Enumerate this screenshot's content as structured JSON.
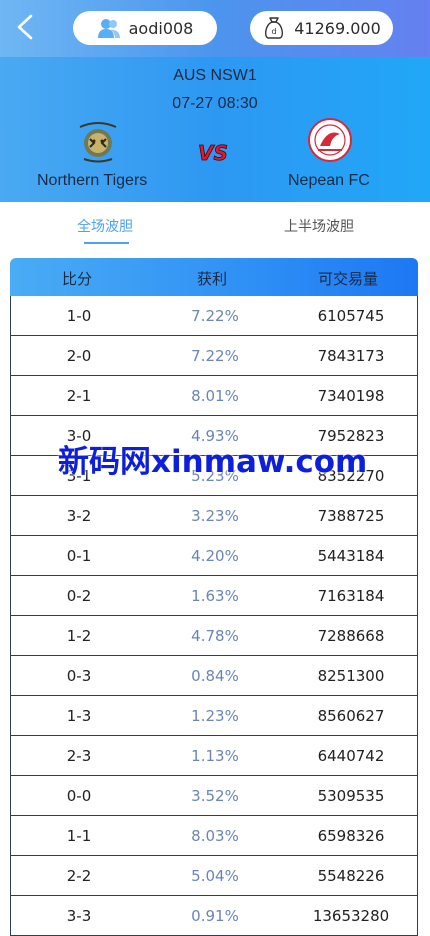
{
  "header": {
    "username": "aodi008",
    "balance": "41269.000"
  },
  "match": {
    "league": "AUS NSW1",
    "time": "07-27 08:30",
    "home_team": "Northern Tigers",
    "away_team": "Nepean FC"
  },
  "tabs": [
    {
      "label": "全场波胆",
      "active": true
    },
    {
      "label": "上半场波胆",
      "active": false
    }
  ],
  "table": {
    "headers": [
      "比分",
      "获利",
      "可交易量"
    ],
    "rows": [
      {
        "score": "1-0",
        "profit": "7.22%",
        "volume": "6105745"
      },
      {
        "score": "2-0",
        "profit": "7.22%",
        "volume": "7843173"
      },
      {
        "score": "2-1",
        "profit": "8.01%",
        "volume": "7340198"
      },
      {
        "score": "3-0",
        "profit": "4.93%",
        "volume": "7952823"
      },
      {
        "score": "3-1",
        "profit": "5.23%",
        "volume": "8352270"
      },
      {
        "score": "3-2",
        "profit": "3.23%",
        "volume": "7388725"
      },
      {
        "score": "0-1",
        "profit": "4.20%",
        "volume": "5443184"
      },
      {
        "score": "0-2",
        "profit": "1.63%",
        "volume": "7163184"
      },
      {
        "score": "1-2",
        "profit": "4.78%",
        "volume": "7288668"
      },
      {
        "score": "0-3",
        "profit": "0.84%",
        "volume": "8251300"
      },
      {
        "score": "1-3",
        "profit": "1.23%",
        "volume": "8560627"
      },
      {
        "score": "2-3",
        "profit": "1.13%",
        "volume": "6440742"
      },
      {
        "score": "0-0",
        "profit": "3.52%",
        "volume": "5309535"
      },
      {
        "score": "1-1",
        "profit": "8.03%",
        "volume": "6598326"
      },
      {
        "score": "2-2",
        "profit": "5.04%",
        "volume": "5548226"
      },
      {
        "score": "3-3",
        "profit": "0.91%",
        "volume": "13653280"
      }
    ]
  },
  "watermark": "新码网xinmaw.com",
  "colors": {
    "accent": "#4aa3f5",
    "profit_text": "#6a85b6",
    "watermark": "#0d1fd8"
  },
  "icons": {
    "back": "chevron-left-icon",
    "user": "user-icon",
    "balance": "money-bag-icon",
    "vs": "vs-icon"
  }
}
